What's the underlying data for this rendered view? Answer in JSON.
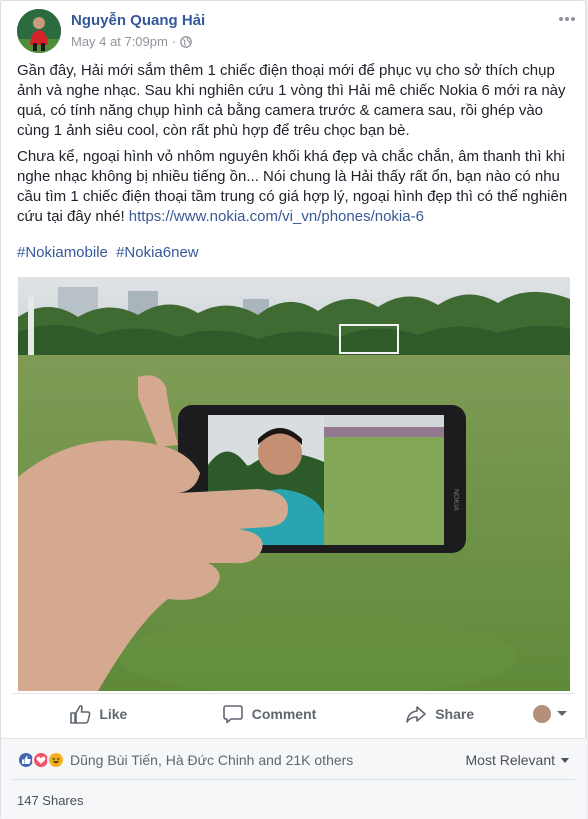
{
  "post": {
    "author": "Nguyễn Quang Hải",
    "timestamp": "May 4 at 7:09pm",
    "separator": "·",
    "paragraph1": "Gần đây, Hải mới sắm thêm 1 chiếc điện thoại mới để phục vụ cho sở thích chụp ảnh và nghe nhạc. Sau khi nghiên cứu 1 vòng thì Hải mê chiếc Nokia 6 mới ra này quá, có tính năng chụp hình cả bằng camera trước & camera sau, rồi ghép vào cùng 1 ảnh siêu cool, còn rất phù hợp để trêu chọc bạn bè.",
    "paragraph2_text": "Chưa kể, ngoại hình vỏ nhôm nguyên khối khá đẹp và chắc chắn, âm thanh thì khi nghe nhạc không bị nhiều tiếng ồn... Nói chung là Hải thấy rất ổn, bạn nào có nhu cầu tìm 1 chiếc điện thoại tầm trung có giá hợp lý, ngoại hình đẹp thì có thể nghiên cứu tại đây nhé!",
    "paragraph2_link": "https://www.nokia.com/vi_vn/phones/nokia-6",
    "hashtags": [
      "#Nokiamobile",
      "#Nokia6new"
    ],
    "phone_brand": "NOKIA"
  },
  "actions": {
    "like": "Like",
    "comment": "Comment",
    "share": "Share"
  },
  "footer": {
    "reactors": "Dũng Bùi Tiến, Hà Đức Chinh and 21K others",
    "sort_label": "Most Relevant",
    "shares": "147 Shares"
  },
  "colors": {
    "link": "#365899",
    "like_blue": "#4267b2",
    "love_red": "#f25268",
    "haha_yellow": "#f7b125"
  }
}
